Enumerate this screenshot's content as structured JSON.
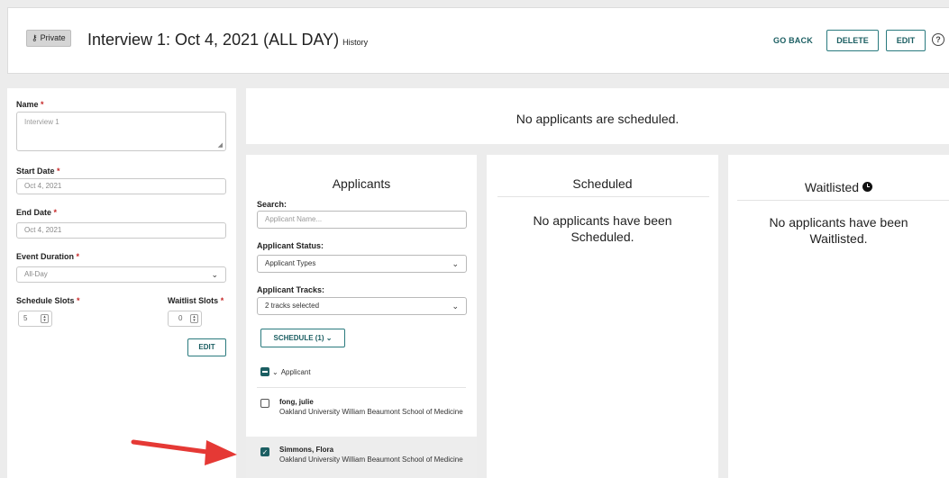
{
  "header": {
    "private_label": "Private",
    "title": "Interview 1: Oct 4, 2021 (ALL DAY)",
    "history_label": "History",
    "go_back_label": "GO BACK",
    "delete_label": "DELETE",
    "edit_label": "EDIT",
    "help_icon": "?"
  },
  "form": {
    "name_label": "Name",
    "name_placeholder": "Interview 1",
    "start_date_label": "Start Date",
    "start_date_value": "Oct 4, 2021",
    "end_date_label": "End Date",
    "end_date_value": "Oct 4, 2021",
    "event_duration_label": "Event Duration",
    "event_duration_value": "All-Day",
    "schedule_slots_label": "Schedule Slots",
    "schedule_slots_value": "5",
    "waitlist_slots_label": "Waitlist Slots",
    "waitlist_slots_value": "0",
    "required_mark": "*",
    "edit_label": "EDIT"
  },
  "banner": {
    "text": "No applicants are scheduled."
  },
  "applicants": {
    "title": "Applicants",
    "search_label": "Search:",
    "search_placeholder": "Applicant Name...",
    "status_label": "Applicant Status:",
    "status_value": "Applicant Types",
    "tracks_label": "Applicant Tracks:",
    "tracks_value": "2 tracks selected",
    "schedule_button": "SCHEDULE (1) ⌄",
    "column_header": "Applicant",
    "rows": [
      {
        "name": "fong, julie",
        "school": "Oakland University William Beaumont School of Medicine",
        "checked": false
      },
      {
        "name": "Simmons, Flora",
        "school": "Oakland University William Beaumont School of Medicine",
        "checked": true
      }
    ]
  },
  "scheduled": {
    "title": "Scheduled",
    "message": "No applicants have been Scheduled."
  },
  "waitlisted": {
    "title": "Waitlisted",
    "message": "No applicants have been Waitlisted."
  },
  "colors": {
    "accent": "#1b5e62",
    "required": "#c62828",
    "annotation_arrow": "#e53935"
  }
}
